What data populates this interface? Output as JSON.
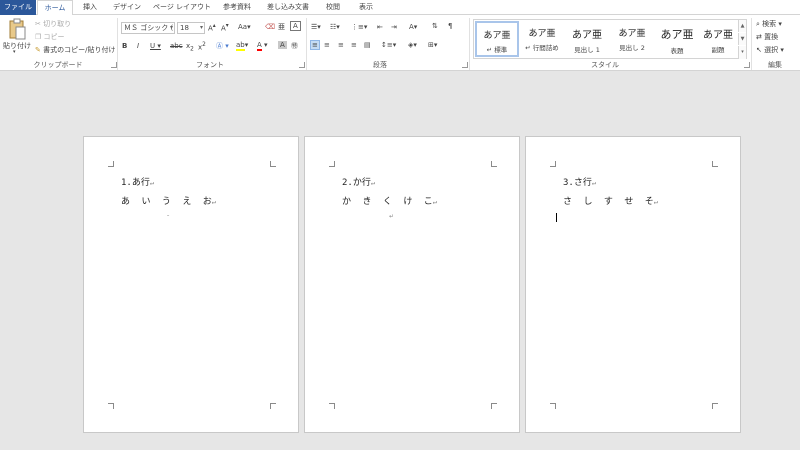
{
  "tabs": [
    "ファイル",
    "ホーム",
    "挿入",
    "デザイン",
    "ページ レイアウト",
    "参考資料",
    "差し込み文書",
    "校閲",
    "表示"
  ],
  "clipboard": {
    "paste": "貼り付け",
    "cut": "切り取り",
    "copy": "コピー",
    "format_painter": "書式のコピー/貼り付け",
    "group": "クリップボード"
  },
  "font": {
    "name": "ＭＳ ゴシック (",
    "size": "18",
    "group": "フォント"
  },
  "paragraph": {
    "group": "段落"
  },
  "styles": {
    "group": "スタイル",
    "items": [
      {
        "sample": "あア亜",
        "name": "↵ 標準"
      },
      {
        "sample": "あア亜",
        "name": "↵ 行間詰め"
      },
      {
        "sample": "あア亜",
        "name": "見出し 1"
      },
      {
        "sample": "あア亜",
        "name": "見出し 2"
      },
      {
        "sample": "あア亜",
        "name": "表題"
      },
      {
        "sample": "あア亜",
        "name": "副題"
      }
    ]
  },
  "editing": {
    "group": "編集",
    "find": "検索",
    "replace": "置換",
    "select": "選択"
  },
  "pages": [
    {
      "heading": "1.あ行",
      "kana": [
        "あ",
        "い",
        "う",
        "え",
        "お"
      ]
    },
    {
      "heading": "2.か行",
      "kana": [
        "か",
        "き",
        "く",
        "け",
        "こ"
      ]
    },
    {
      "heading": "3.さ行",
      "kana": [
        "さ",
        "し",
        "す",
        "せ",
        "そ"
      ]
    }
  ],
  "para_mark": "↵"
}
